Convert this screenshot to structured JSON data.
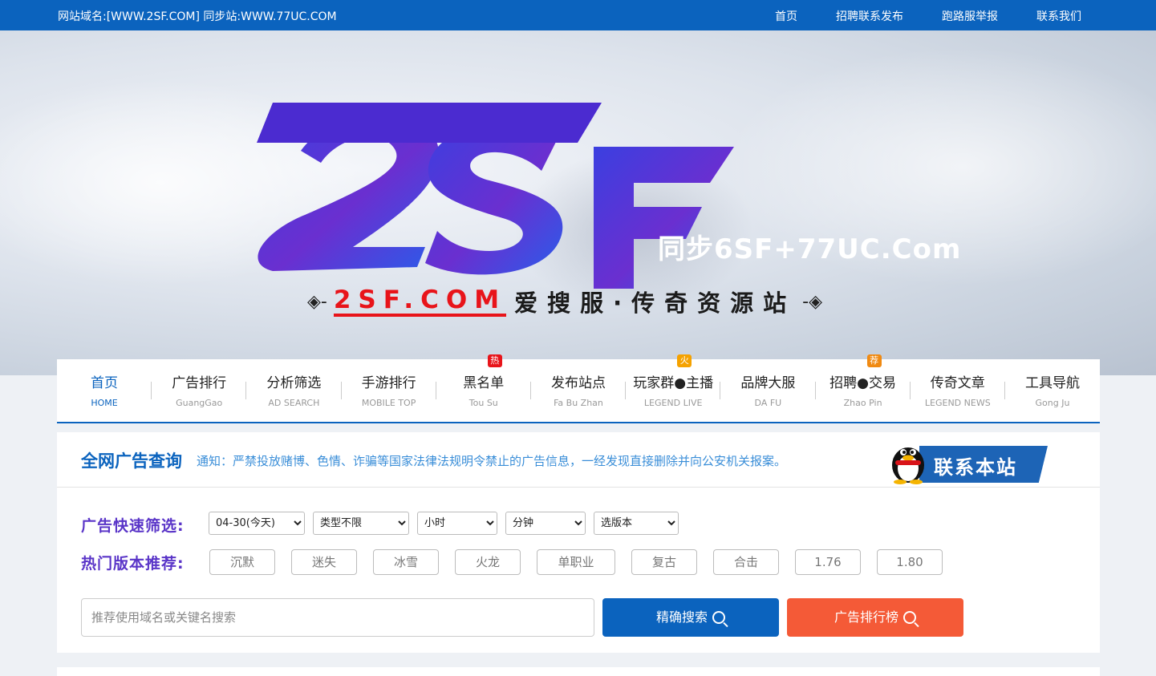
{
  "topbar": {
    "domain_text": "网站域名:[WWW.2SF.COM] 同步站:WWW.77UC.COM",
    "links": [
      "首页",
      "招聘联系发布",
      "跑路服举报",
      "联系我们"
    ]
  },
  "hero": {
    "logo_text": "2SF",
    "sync_text": "同步6SF+77UC.Com",
    "site_name": "2SF.COM",
    "slogan": "爱搜服·传奇资源站",
    "brand_colors": {
      "logo_start": "#5a3ed6",
      "logo_end": "#1f5de6",
      "accent_red": "#e8141a"
    }
  },
  "nav": {
    "items": [
      {
        "cn": "首页",
        "en": "HOME",
        "active": true
      },
      {
        "cn": "广告排行",
        "en": "GuangGao"
      },
      {
        "cn": "分析筛选",
        "en": "AD SEARCH"
      },
      {
        "cn": "手游排行",
        "en": "MOBILE TOP"
      },
      {
        "cn": "黑名单",
        "en": "Tou Su",
        "badge": "热"
      },
      {
        "cn": "发布站点",
        "en": "Fa Bu Zhan"
      },
      {
        "cn": "玩家群●主播",
        "en": "LEGEND LIVE",
        "badge": "火"
      },
      {
        "cn": "品牌大服",
        "en": "DA FU"
      },
      {
        "cn": "招聘●交易",
        "en": "Zhao Pin",
        "badge": "荐"
      },
      {
        "cn": "传奇文章",
        "en": "LEGEND NEWS"
      },
      {
        "cn": "工具导航",
        "en": "Gong Ju"
      }
    ]
  },
  "panel": {
    "title": "全网广告查询",
    "notice": "通知：严禁投放赌博、色情、诈骗等国家法律法规明令禁止的广告信息，一经发现直接删除并向公安机关报案。",
    "contact_label": "联系本站",
    "filter_label": "广告快速筛选:",
    "filters": {
      "date": "04-30(今天)",
      "type": "类型不限",
      "hour": "小时",
      "minute": "分钟",
      "version": "选版本"
    },
    "hot_label": "热门版本推荐:",
    "hot_tags": [
      "沉默",
      "迷失",
      "冰雪",
      "火龙",
      "单职业",
      "复古",
      "合击",
      "1.76",
      "1.80"
    ],
    "search_placeholder": "推荐使用域名或关键名搜索",
    "search_button": "精确搜索",
    "rank_button": "广告排行榜",
    "colors": {
      "primary": "#0b63be",
      "rank": "#f45a37",
      "label": "#5a35c8"
    }
  }
}
